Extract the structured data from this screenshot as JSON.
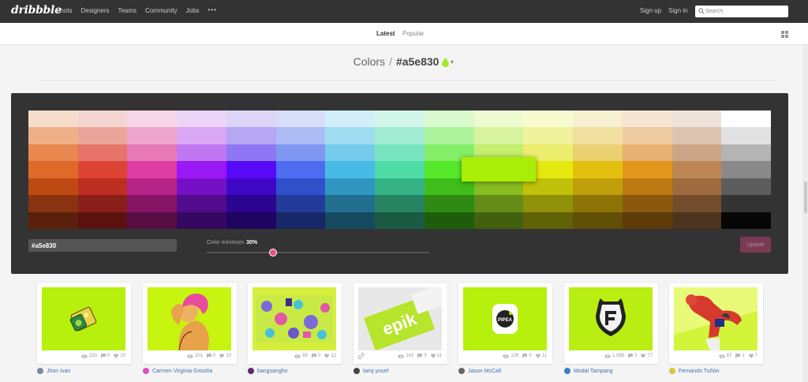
{
  "nav": {
    "logo": "dribbble",
    "links": [
      "Shots",
      "Designers",
      "Teams",
      "Community",
      "Jobs"
    ],
    "more": "•••",
    "sign_up": "Sign up",
    "sign_in": "Sign in",
    "search_placeholder": "Search"
  },
  "subnav": {
    "latest": "Latest",
    "popular": "Popular"
  },
  "title": {
    "section": "Colors",
    "separator": "/",
    "color": "#a5e830"
  },
  "palette": {
    "hex_value": "#a5e830",
    "min_label": "Color minimum",
    "min_value": "30%",
    "min_fraction": 0.3,
    "update_label": "Update",
    "selected_color": "#a8ee06",
    "accent": "#ea4c89",
    "columns": [
      [
        "#f6dccb",
        "#efb088",
        "#e8874e",
        "#e0692a",
        "#bd4a12",
        "#893311",
        "#5a2009"
      ],
      [
        "#f4d4d0",
        "#eca59b",
        "#e57368",
        "#dd4436",
        "#bd2d22",
        "#8a1e18",
        "#5b120f"
      ],
      [
        "#f6d5e8",
        "#eea6cf",
        "#e679b6",
        "#de3ca0",
        "#b72487",
        "#861665",
        "#570d44"
      ],
      [
        "#ecd4f6",
        "#d9a7f3",
        "#c177f2",
        "#9a17f6",
        "#7610c4",
        "#530b8e",
        "#360760"
      ],
      [
        "#dcd5f7",
        "#b5a7f4",
        "#8e77f4",
        "#5809f8",
        "#3f07c6",
        "#2b058f",
        "#1d0561"
      ],
      [
        "#d7def7",
        "#acbbf4",
        "#7f97f1",
        "#4d6cef",
        "#2f4fcb",
        "#223b98",
        "#172767"
      ],
      [
        "#d2eef8",
        "#9fdcf2",
        "#75cbec",
        "#47bbe6",
        "#2f97c0",
        "#226e8e",
        "#154960"
      ],
      [
        "#d2f5e9",
        "#a1ecd2",
        "#78e5c0",
        "#4fdca7",
        "#35b386",
        "#278462",
        "#1a5a43"
      ],
      [
        "#d9f9cf",
        "#aef49c",
        "#85ef68",
        "#56e82a",
        "#3fbd1a",
        "#2e8a12",
        "#1e5e0b"
      ],
      [
        "#eefad0",
        "#d7f39d",
        "#c3ee6e",
        "#abe93c",
        "#88bd20",
        "#648c16",
        "#43600e"
      ],
      [
        "#f8fad0",
        "#f1f39c",
        "#ebee6c",
        "#e6e90d",
        "#c0c20a",
        "#8f9108",
        "#616205"
      ],
      [
        "#f7f0d2",
        "#f0df9f",
        "#ead071",
        "#e4c00e",
        "#c09f0a",
        "#8d7408",
        "#614f05"
      ],
      [
        "#f6e5d3",
        "#efcba1",
        "#e8b072",
        "#e2961a",
        "#be7a12",
        "#8a590d",
        "#5d3c09"
      ],
      [
        "#ede3da",
        "#dcc4b1",
        "#cba585",
        "#bc8755",
        "#9e6b3e",
        "#734e2d",
        "#4d341e"
      ],
      [
        "#ffffff",
        "#e2e2e2",
        "#b4b4b4",
        "#898989",
        "#5d5d5d",
        "#333333",
        "#070707"
      ]
    ]
  },
  "shots": [
    {
      "views": "233",
      "comments": "0",
      "likes": "10",
      "author": "Jhon Ivan",
      "avatar_color": "#7b8a9a"
    },
    {
      "views": "101",
      "comments": "0",
      "likes": "10",
      "author": "Carmen Virginia Grisolía",
      "avatar_color": "#e34fc0"
    },
    {
      "views": "85",
      "comments": "0",
      "likes": "12",
      "author": "bangsangho",
      "avatar_color": "#5a2c66"
    },
    {
      "views": "142",
      "comments": "0",
      "likes": "11",
      "author": "tariq yosef",
      "avatar_color": "#444444",
      "has_link": true
    },
    {
      "views": "126",
      "comments": "0",
      "likes": "11",
      "author": "Jason McCall",
      "avatar_color": "#666666"
    },
    {
      "views": "1,086",
      "comments": "3",
      "likes": "77",
      "author": "Modal Tampang",
      "avatar_color": "#3d7fbf"
    },
    {
      "views": "87",
      "comments": "1",
      "likes": "7",
      "author": "Fernando Tuñón",
      "avatar_color": "#d6c83a"
    }
  ],
  "shot_texts": [
    "epik",
    "PIPEA"
  ]
}
